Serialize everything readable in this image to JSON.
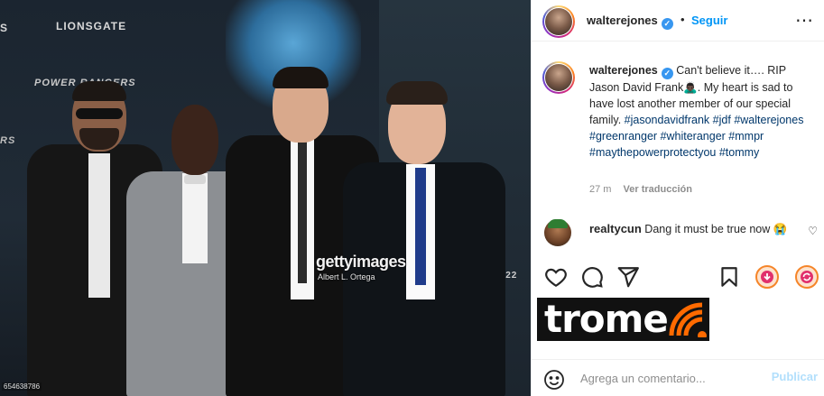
{
  "photo": {
    "banner_lionsgate": "LIONSGATE",
    "banner_power_rangers": "POWER RANGERS",
    "banner_edge_top": "S",
    "banner_edge_mid": "RS",
    "banner_date": "CH 22",
    "watermark_logo": "gettyimages",
    "watermark_credit": "Albert L. Ortega",
    "photo_id": "654638786"
  },
  "header": {
    "username": "walterejones",
    "separator": "•",
    "follow_label": "Seguir",
    "more_icon": "more-horizontal-icon"
  },
  "caption": {
    "username": "walterejones",
    "text_1": "Can't believe it…. RIP Jason David Frank",
    "emoji": "🙇🏿‍♂️",
    "text_2": ". My heart is sad to have lost another member of our special family.",
    "hashtags": [
      "#jasondavidfrank",
      "#jdf",
      "#walterejones",
      "#greenranger",
      "#whiteranger",
      "#mmpr",
      "#maythepowerprotectyou",
      "#tommy"
    ],
    "time": "27 m",
    "translate_label": "Ver traducción"
  },
  "comment": {
    "username": "realtycun",
    "text": "Dang it must be true now",
    "emoji": "😭"
  },
  "actions": {
    "like_icon": "heart-icon",
    "comment_icon": "comment-icon",
    "share_icon": "share-icon",
    "save_icon": "bookmark-icon"
  },
  "brand": {
    "logo_text": "trome",
    "accent": "#ff6a00"
  },
  "composer": {
    "placeholder": "Agrega un comentario...",
    "publish_label": "Publicar"
  },
  "colors": {
    "link_blue": "#0095f6",
    "hashtag": "#00376b",
    "muted": "#8e8e8e"
  }
}
